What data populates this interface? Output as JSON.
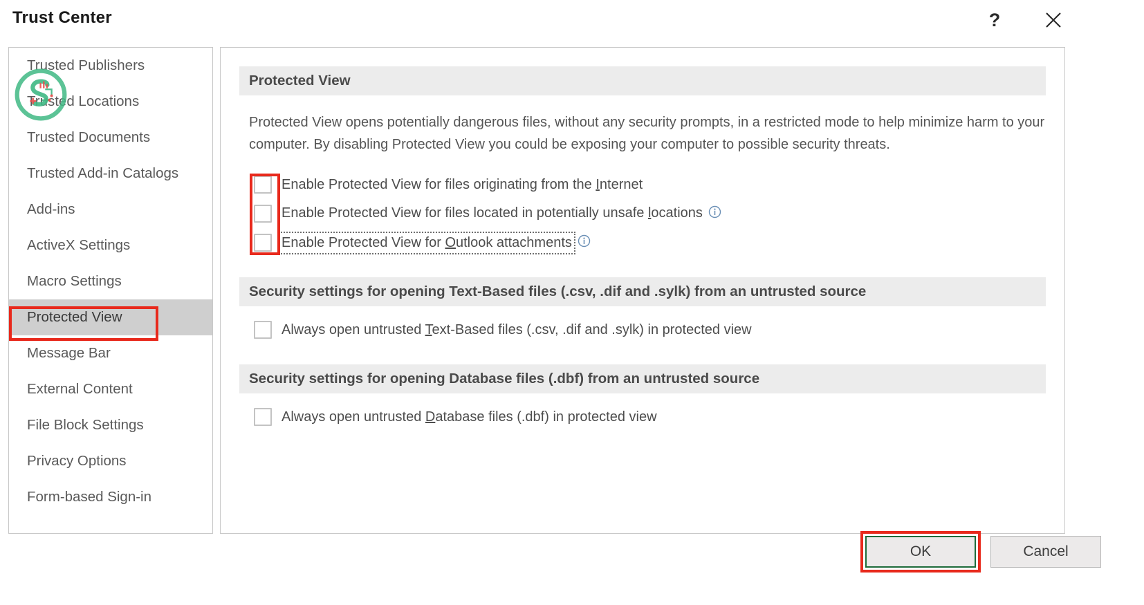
{
  "window": {
    "title": "Trust Center",
    "help_icon": "question-mark-icon",
    "close_icon": "close-icon"
  },
  "sidebar": {
    "items": [
      {
        "label": "Trusted Publishers",
        "selected": false
      },
      {
        "label": "Trusted Locations",
        "selected": false
      },
      {
        "label": "Trusted Documents",
        "selected": false
      },
      {
        "label": "Trusted Add-in Catalogs",
        "selected": false
      },
      {
        "label": "Add-ins",
        "selected": false
      },
      {
        "label": "ActiveX Settings",
        "selected": false
      },
      {
        "label": "Macro Settings",
        "selected": false
      },
      {
        "label": "Protected View",
        "selected": true
      },
      {
        "label": "Message Bar",
        "selected": false
      },
      {
        "label": "External Content",
        "selected": false
      },
      {
        "label": "File Block Settings",
        "selected": false
      },
      {
        "label": "Privacy Options",
        "selected": false
      },
      {
        "label": "Form-based Sign-in",
        "selected": false
      }
    ]
  },
  "main": {
    "section_protected_view": {
      "heading": "Protected View",
      "description": "Protected View opens potentially dangerous files, without any security prompts, in a restricted mode to help minimize harm to your computer. By disabling Protected View you could be exposing your computer to possible security threats.",
      "checkboxes": [
        {
          "label_before": "Enable Protected View for files originating from the ",
          "accelerator": "I",
          "label_after": "nternet",
          "checked": false,
          "has_info_icon": false,
          "focused": false
        },
        {
          "label_before": "Enable Protected View for files located in potentially unsafe ",
          "accelerator": "l",
          "label_after": "ocations",
          "checked": false,
          "has_info_icon": true,
          "focused": false
        },
        {
          "label_before": "Enable Protected View for ",
          "accelerator": "O",
          "label_after": "utlook attachments",
          "checked": false,
          "has_info_icon": true,
          "focused": true
        }
      ]
    },
    "section_text_based": {
      "heading": "Security settings for opening Text-Based files (.csv, .dif and .sylk) from an untrusted source",
      "checkbox": {
        "label_before": "Always open untrusted ",
        "accelerator": "T",
        "label_after": "ext-Based files (.csv, .dif and .sylk) in protected view",
        "checked": false
      }
    },
    "section_database": {
      "heading": "Security settings for opening Database files (.dbf) from an untrusted source",
      "checkbox": {
        "label_before": "Always open untrusted ",
        "accelerator": "D",
        "label_after": "atabase files (.dbf) in protected view",
        "checked": false
      }
    }
  },
  "footer": {
    "ok_label": "OK",
    "cancel_label": "Cancel"
  },
  "annotations": {
    "highlight_color": "#e8291c",
    "default_button_border_color": "#1e6b3a"
  },
  "watermark": {
    "name": "s-circuit-logo-watermark",
    "circle_color": "#3fb884",
    "accent_color": "#e8504d"
  }
}
